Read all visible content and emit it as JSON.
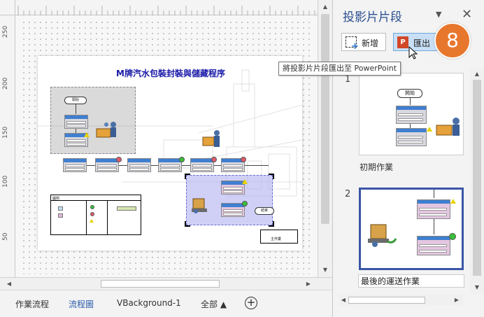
{
  "window": {
    "pane_title": "投影片片段"
  },
  "ruler": {
    "top": [],
    "left": [
      "250",
      "200",
      "150",
      "100",
      "50"
    ]
  },
  "drawing": {
    "page_title": "M牌汽水包裝封裝與儲藏程序",
    "start_label": "開始",
    "end_label": "結束",
    "legend_title": "圖例",
    "stamp_text": "主作業"
  },
  "pane": {
    "title": "投影片片段",
    "new_button": "新增",
    "export_button": "匯出",
    "export_icon": "P",
    "step_badge": "8",
    "tooltip": "將投影片片段匯出至 PowerPoint",
    "thumbnails": [
      {
        "number": "1",
        "label": "初期作業",
        "thumb_label": "開始"
      },
      {
        "number": "2",
        "label": "最後的運送作業"
      }
    ]
  },
  "tabs": {
    "items": [
      {
        "label": "作業流程"
      },
      {
        "label": "流程圖"
      },
      {
        "label": "VBackground-1"
      }
    ],
    "all_label": "全部 ▲",
    "add_label": "+"
  },
  "icons": {
    "close": "close-icon",
    "menu": "dropdown-arrow-icon",
    "new": "new-snippet-icon",
    "export": "powerpoint-icon"
  },
  "colors": {
    "accent": "#2a4f90",
    "badge": "#e8772e",
    "export_active": "#c9dff5",
    "powerpoint": "#d24726",
    "diagram_title": "#1a1aa8"
  }
}
